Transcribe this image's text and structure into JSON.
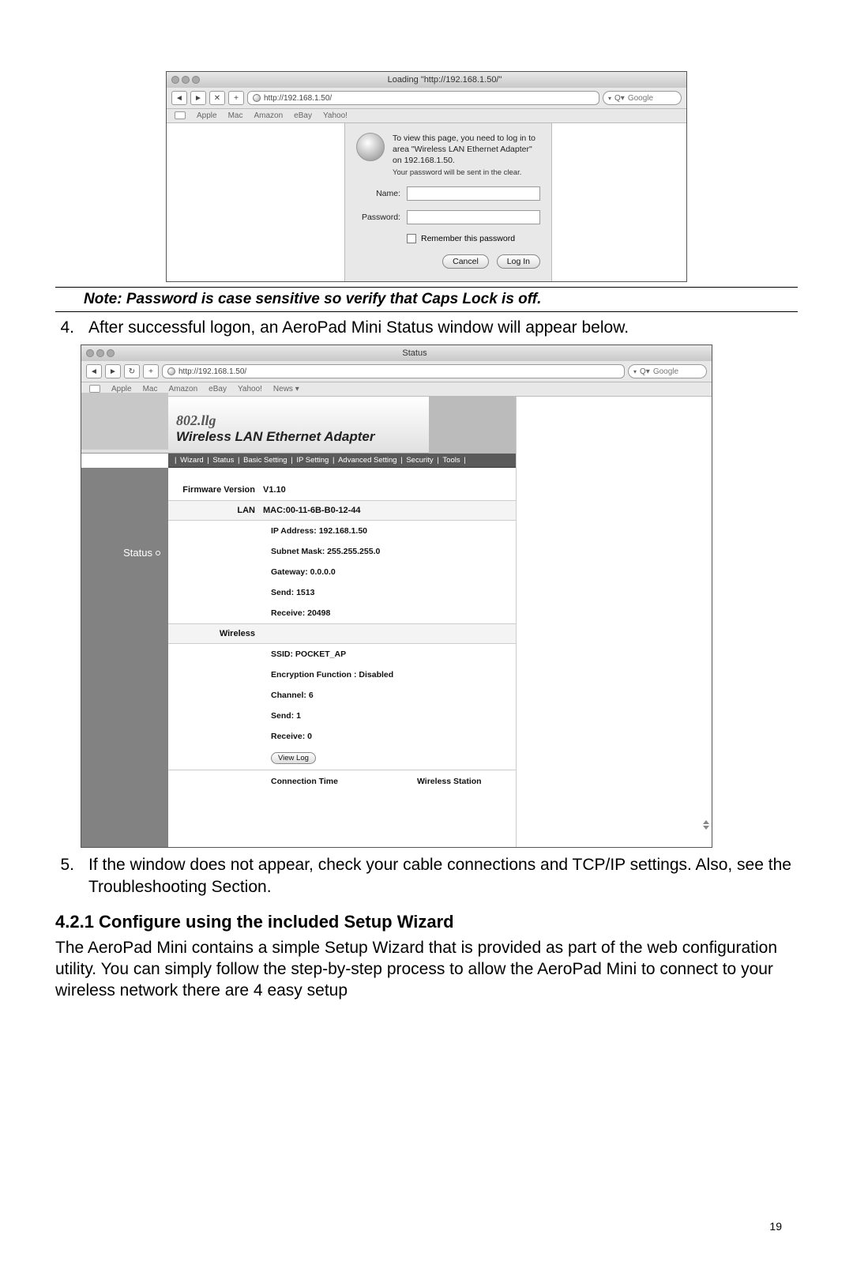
{
  "page_number": "19",
  "login_shot": {
    "title": "Loading \"http://192.168.1.50/\"",
    "url": "http://192.168.1.50/",
    "bookmarks": [
      "Apple",
      "Mac",
      "Amazon",
      "eBay",
      "Yahoo!"
    ],
    "search_placeholder": "Google",
    "message": "To view this page, you need to log in to area \"Wireless LAN Ethernet Adapter\" on 192.168.1.50.",
    "warning": "Your password will be sent in the clear.",
    "name_label": "Name:",
    "password_label": "Password:",
    "remember_label": "Remember this password",
    "cancel": "Cancel",
    "login": "Log In"
  },
  "note": "Note: Password is case sensitive so verify that Caps Lock is off.",
  "step4": "After successful logon, an AeroPad Mini Status window will appear below.",
  "status_shot": {
    "title": "Status",
    "url": "http://192.168.1.50/",
    "bookmarks": [
      "Apple",
      "Mac",
      "Amazon",
      "eBay",
      "Yahoo!",
      "News ▾"
    ],
    "search_placeholder": "Google",
    "banner_line1": "802.llg",
    "banner_line2": "Wireless LAN Ethernet Adapter",
    "menu": [
      "Wizard",
      "Status",
      "Basic Setting",
      "IP Setting",
      "Advanced Setting",
      "Security",
      "Tools"
    ],
    "sidebar_label": "Status",
    "firmware_label": "Firmware Version",
    "firmware_value": "V1.10",
    "lan_label": "LAN",
    "lan": {
      "mac": "MAC:00-11-6B-B0-12-44",
      "ip": "IP Address: 192.168.1.50",
      "subnet": "Subnet Mask: 255.255.255.0",
      "gateway": "Gateway: 0.0.0.0",
      "send": "Send: 1513",
      "receive": "Receive: 20498"
    },
    "wireless_label": "Wireless",
    "wireless": {
      "ssid": "SSID: POCKET_AP",
      "enc": "Encryption Function : Disabled",
      "channel": "Channel: 6",
      "send": "Send: 1",
      "receive": "Receive: 0"
    },
    "view_log": "View Log",
    "conn_time": "Connection Time",
    "wstation": "Wireless Station"
  },
  "step5": "If the window does not appear, check your cable connections and TCP/IP settings. Also, see the Troubleshooting Section.",
  "section_heading": "4.2.1 Configure using the included Setup Wizard",
  "section_body": "The AeroPad Mini contains a simple Setup Wizard that is provided as part of the web configuration utility.  You can simply follow the step-by-step process to allow the AeroPad Mini to connect to your wireless network there are 4 easy setup"
}
